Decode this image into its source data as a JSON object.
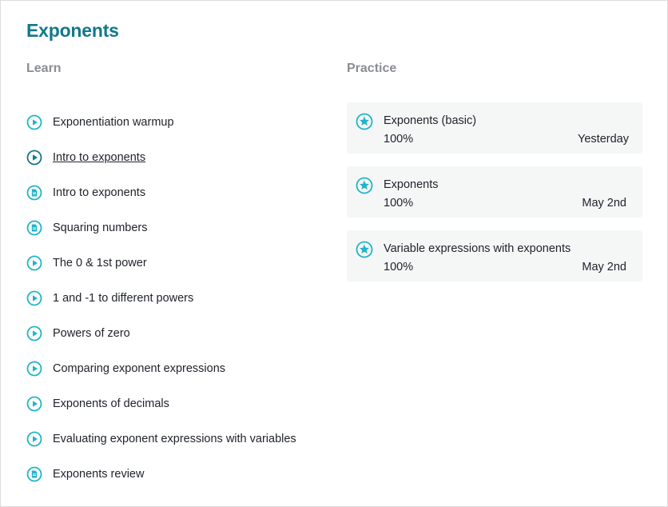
{
  "title": "Exponents",
  "learn": {
    "heading": "Learn",
    "items": [
      {
        "label": "Exponentiation warmup",
        "type": "video",
        "active": false
      },
      {
        "label": "Intro to exponents",
        "type": "video",
        "active": true
      },
      {
        "label": "Intro to exponents",
        "type": "article",
        "active": false
      },
      {
        "label": "Squaring numbers",
        "type": "article",
        "active": false
      },
      {
        "label": "The 0 & 1st power",
        "type": "video",
        "active": false
      },
      {
        "label": "1 and -1 to different powers",
        "type": "video",
        "active": false
      },
      {
        "label": "Powers of zero",
        "type": "video",
        "active": false
      },
      {
        "label": "Comparing exponent expressions",
        "type": "video",
        "active": false
      },
      {
        "label": "Exponents of decimals",
        "type": "video",
        "active": false
      },
      {
        "label": "Evaluating exponent expressions with variables",
        "type": "video",
        "active": false
      },
      {
        "label": "Exponents review",
        "type": "article",
        "active": false
      }
    ]
  },
  "practice": {
    "heading": "Practice",
    "items": [
      {
        "title": "Exponents (basic)",
        "score": "100%",
        "date": "Yesterday"
      },
      {
        "title": "Exponents",
        "score": "100%",
        "date": "May 2nd"
      },
      {
        "title": "Variable expressions with exponents",
        "score": "100%",
        "date": "May 2nd"
      }
    ]
  },
  "colors": {
    "accent": "#11788c",
    "icon": "#1fb5c8",
    "heading_gray": "#8a8d93",
    "card_bg": "#f5f6f6"
  },
  "icons": {
    "video": "play-icon",
    "article": "article-icon",
    "practice": "star-icon"
  }
}
